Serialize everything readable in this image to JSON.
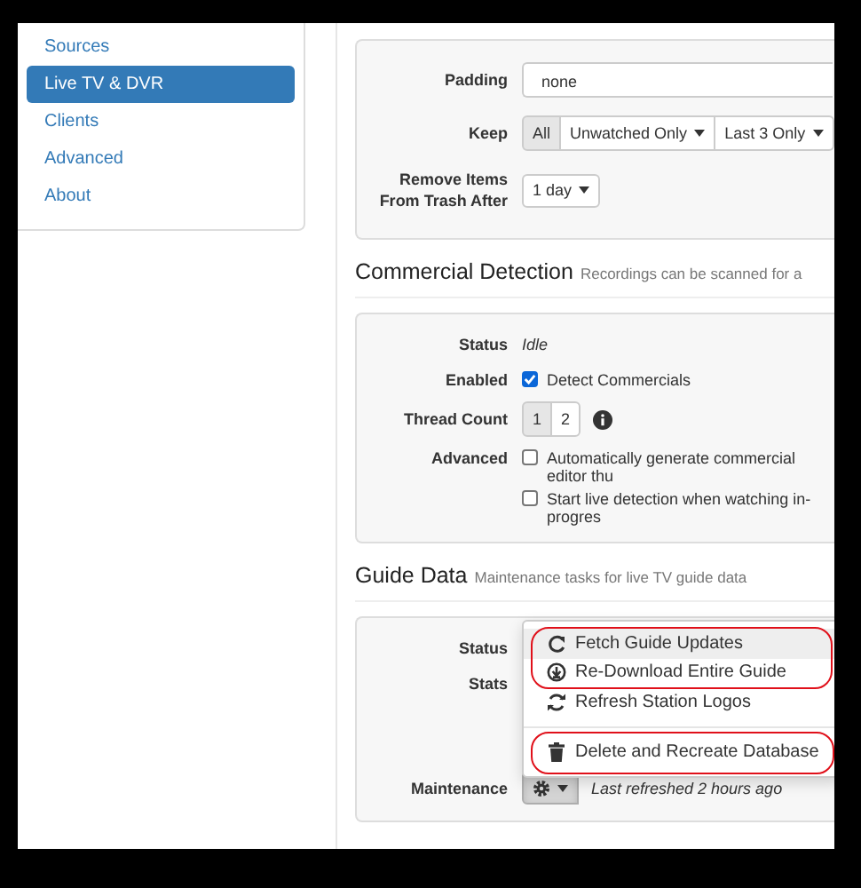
{
  "sidebar": {
    "items": [
      {
        "label": "Sources",
        "selected": false
      },
      {
        "label": "Live TV & DVR",
        "selected": true
      },
      {
        "label": "Clients",
        "selected": false
      },
      {
        "label": "Advanced",
        "selected": false
      },
      {
        "label": "About",
        "selected": false
      }
    ]
  },
  "recording_panel": {
    "rows": [
      {
        "kind": "input",
        "label": "Padding",
        "value": "none"
      },
      {
        "kind": "button_group",
        "label": "Keep",
        "buttons": [
          {
            "label": "All",
            "selected": true,
            "dropdown": false
          },
          {
            "label": "Unwatched Only",
            "selected": false,
            "dropdown": true
          },
          {
            "label": "Last 3 Only",
            "selected": false,
            "dropdown": true
          }
        ]
      },
      {
        "kind": "dropdown",
        "label": "Remove Items\nFrom Trash After",
        "value": "1 day"
      }
    ]
  },
  "commercial_detection": {
    "title": "Commercial Detection",
    "subtitle": "Recordings can be scanned for a",
    "rows": [
      {
        "kind": "text",
        "label": "Status",
        "value": "Idle"
      },
      {
        "kind": "checkboxes",
        "label": "Enabled",
        "options": [
          {
            "label": "Detect Commercials",
            "checked": true
          }
        ]
      },
      {
        "kind": "button_group",
        "label": "Thread Count",
        "info": true,
        "buttons": [
          {
            "label": "1",
            "selected": true,
            "dropdown": false
          },
          {
            "label": "2",
            "selected": false,
            "dropdown": false
          }
        ]
      },
      {
        "kind": "checkboxes",
        "label": "Advanced",
        "options": [
          {
            "label": "Automatically generate commercial editor thu",
            "checked": false
          },
          {
            "label": "Start live detection when watching in-progres",
            "checked": false
          }
        ]
      }
    ]
  },
  "guide_data": {
    "title": "Guide Data",
    "subtitle": "Maintenance tasks for live TV guide data",
    "rows": [
      {
        "kind": "text",
        "label": "Status"
      },
      {
        "kind": "text",
        "label": "Stats"
      },
      {
        "kind": "menu_button",
        "label": "Maintenance",
        "note": "Last refreshed 2 hours ago",
        "open": true
      }
    ],
    "menu": {
      "groups": [
        {
          "circled": true,
          "divider_before": false,
          "items": [
            {
              "kind": "fetch",
              "label": "Fetch Guide Updates",
              "selected": true
            },
            {
              "kind": "download",
              "label": "Re-Download Entire Guide",
              "selected": false
            }
          ]
        },
        {
          "circled": false,
          "divider_before": false,
          "items": [
            {
              "kind": "refresh",
              "label": "Refresh Station Logos",
              "selected": false
            }
          ]
        },
        {
          "circled": true,
          "divider_before": true,
          "items": [
            {
              "kind": "delete",
              "label": "Delete and Recreate Database",
              "selected": false
            }
          ]
        }
      ]
    }
  }
}
